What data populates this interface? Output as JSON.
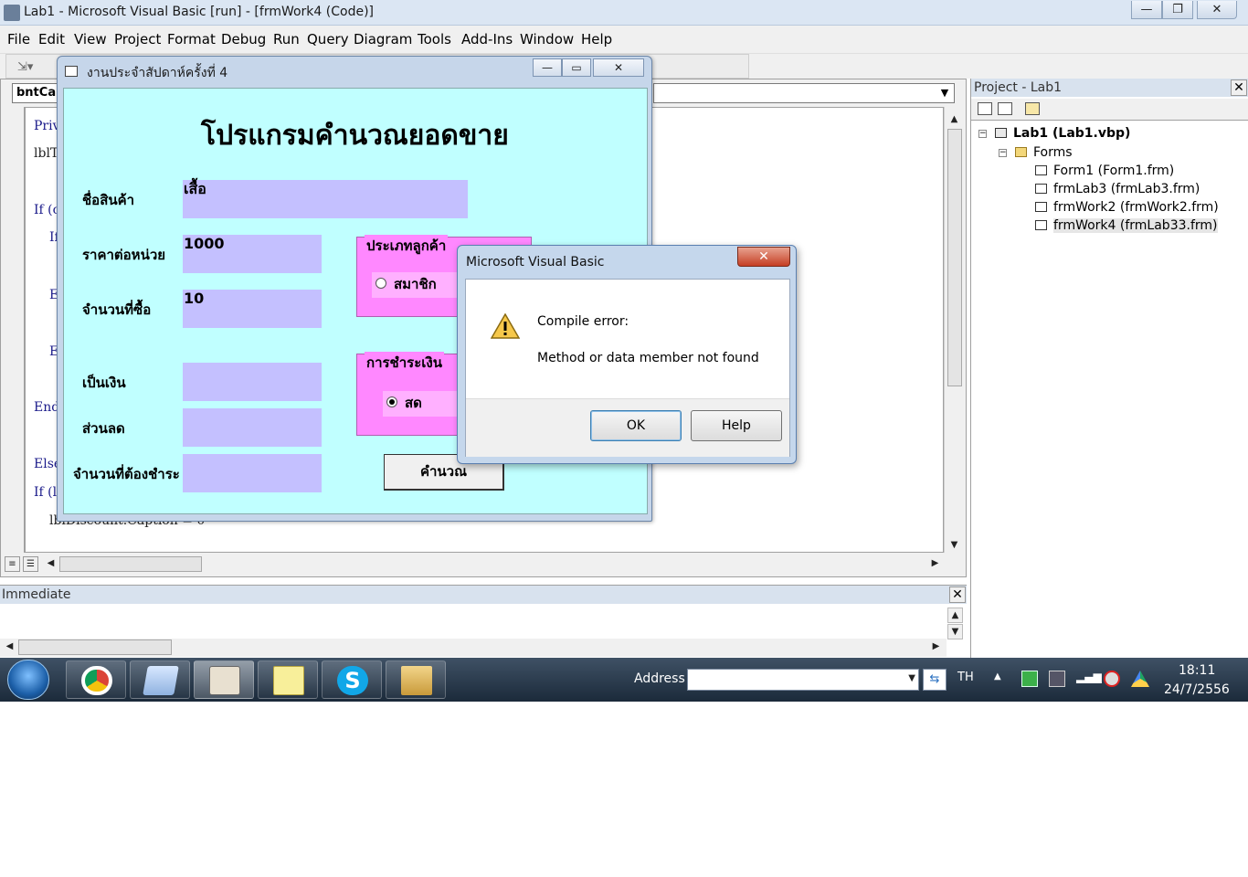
{
  "window": {
    "title": "Lab1 - Microsoft Visual Basic [run] - [frmWork4 (Code)]",
    "minimize": "—",
    "restore": "❐",
    "close": "✕"
  },
  "menu": {
    "items": [
      "File",
      "Edit",
      "View",
      "Project",
      "Format",
      "Debug",
      "Run",
      "Query",
      "Diagram",
      "Tools",
      "Add-Ins",
      "Window",
      "Help"
    ]
  },
  "code_window": {
    "object_combo": "bntCalc",
    "lines": [
      "Priv",
      "lblT",
      "If (c",
      "If",
      "E",
      "E",
      "End",
      "Else",
      "If (l",
      "lblDiscount.Caption = 0"
    ]
  },
  "form": {
    "title": "งานประจำสัปดาห์ครั้งที่ 4",
    "heading": "โปรแกรมคำนวณยอดขาย",
    "labels": {
      "product_name": "ชื่อสินค้า",
      "unit_price": "ราคาต่อหน่วย",
      "quantity": "จำนวนที่ซื้อ",
      "amount": "เป็นเงิน",
      "discount": "ส่วนลด",
      "total_due": "จำนวนที่ต้องชำระ"
    },
    "values": {
      "product_name": "เสื้อ",
      "unit_price": "1000",
      "quantity": "10",
      "amount": "",
      "discount": "",
      "total_due": ""
    },
    "customer_frame": {
      "caption": "ประเภทลูกค้า",
      "option_member": "สมาชิก"
    },
    "payment_frame": {
      "caption": "การชำระเงิน",
      "option_cash": "สด"
    },
    "calculate_button": "คำนวณ"
  },
  "message_box": {
    "title": "Microsoft Visual Basic",
    "close": "✕",
    "icon": "warning-icon",
    "line1": "Compile error:",
    "line2": "Method or data member not found",
    "ok": "OK",
    "help": "Help"
  },
  "project_explorer": {
    "title": "Project - Lab1",
    "close": "✕",
    "project": "Lab1 (Lab1.vbp)",
    "folder": "Forms",
    "forms": [
      "Form1 (Form1.frm)",
      "frmLab3 (frmLab3.frm)",
      "frmWork2 (frmWork2.frm)",
      "frmWork4 (frmLab33.frm)"
    ]
  },
  "immediate": {
    "title": "Immediate",
    "close": "✕"
  },
  "taskbar": {
    "address_label": "Address",
    "address_value": "",
    "language": "TH",
    "time": "18:11",
    "date": "24/7/2556"
  },
  "colors": {
    "form_back": "#c0ffff",
    "textbox_back": "#c4c0ff",
    "frame_back": "#ff88ff",
    "code_keyword": "#1a1a8a"
  }
}
